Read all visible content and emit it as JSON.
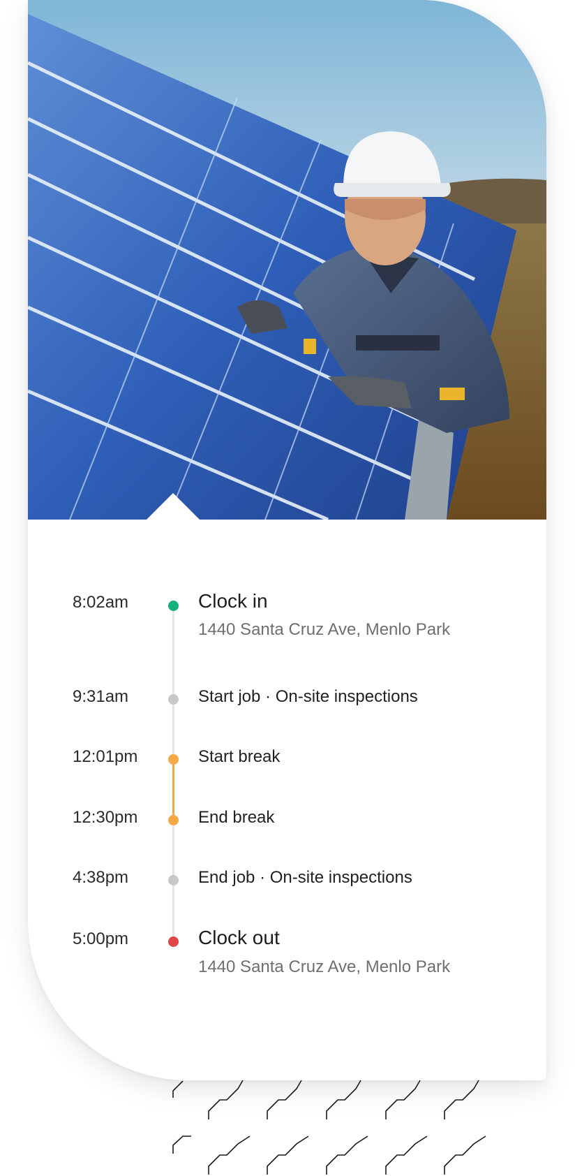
{
  "colors": {
    "clock_in_dot": "#16b07a",
    "job_dot": "#c8c8c8",
    "break_dot": "#f5a946",
    "clock_out_dot": "#e04848",
    "rail": "#e5e5e5"
  },
  "hero_image": {
    "icon": "solar-worker-photo"
  },
  "timeline": {
    "entries": [
      {
        "time": "8:02am",
        "title": "Clock in",
        "subtitle": "1440 Santa Cruz Ave, Menlo Park",
        "kind": "clock-in"
      },
      {
        "time": "9:31am",
        "title": "Start job · On-site inspections",
        "kind": "job"
      },
      {
        "time": "12:01pm",
        "title": "Start break",
        "kind": "break"
      },
      {
        "time": "12:30pm",
        "title": "End break",
        "kind": "break"
      },
      {
        "time": "4:38pm",
        "title": "End job · On-site inspections",
        "kind": "job"
      },
      {
        "time": "5:00pm",
        "title": "Clock out",
        "subtitle": "1440 Santa Cruz Ave, Menlo Park",
        "kind": "clock-out"
      }
    ]
  }
}
